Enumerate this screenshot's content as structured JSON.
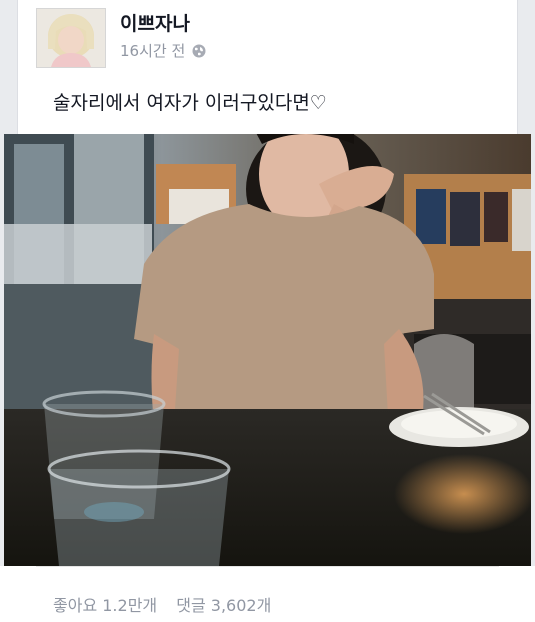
{
  "post": {
    "author": "이쁘자나",
    "time": "16시간 전",
    "privacy_icon": "globe-icon",
    "text": "술자리에서 여자가 이러구있다면♡"
  },
  "stats": {
    "likes": "좋아요 1.2만개",
    "comments": "댓글 3,602개"
  }
}
